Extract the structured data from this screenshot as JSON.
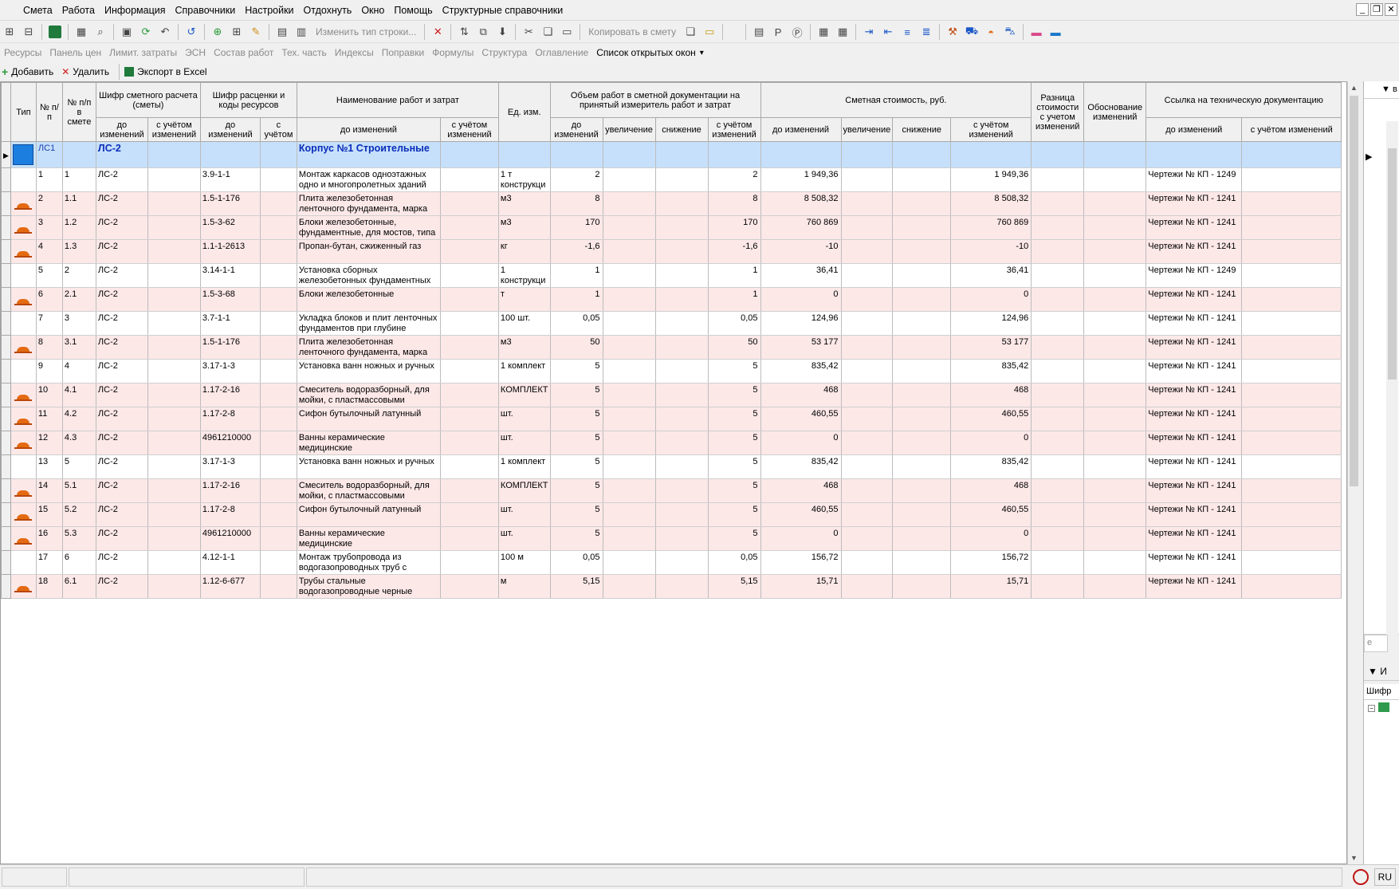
{
  "menu": [
    "Смета",
    "Работа",
    "Информация",
    "Справочники",
    "Настройки",
    "Отдохнуть",
    "Окно",
    "Помощь",
    "Структурные справочники"
  ],
  "toolbar": {
    "change_row_type": "Изменить тип строки...",
    "copy_to_estimate": "Копировать в смету"
  },
  "tabs": [
    "Ресурсы",
    "Панель цен",
    "Лимит. затраты",
    "ЭСН",
    "Состав работ",
    "Тех. часть",
    "Индексы",
    "Поправки",
    "Формулы",
    "Структура",
    "Оглавление",
    "Список открытых окон"
  ],
  "tabs_dropdown_icon": "chevron-down-icon",
  "actions": {
    "add": "Добавить",
    "delete": "Удалить",
    "export": "Экспорт в Excel"
  },
  "headers": {
    "type": "Тип",
    "num": "№ п/п",
    "num_in_estimate": "№ п/п в смете",
    "estimate_code": "Шифр сметного расчета (сметы)",
    "rate_code": "Шифр расценки и коды ресурсов",
    "name": "Наименование работ и затрат",
    "unit": "Ед. изм.",
    "volume": "Объем работ в сметной документации на принятый измеритель работ и затрат",
    "cost": "Сметная стоимость, руб.",
    "diff": "Разница стоимости с учетом изменений",
    "basis": "Обоснование изменений",
    "link": "Ссылка на техническую документацию",
    "before": "до изменений",
    "with_changes": "с учётом изменений",
    "with_short": "с учётом",
    "increase": "увеличение",
    "decrease": "снижение"
  },
  "ls_row": {
    "num": "ЛС1",
    "code": "ЛС-2",
    "name": "Корпус №1 Строительные"
  },
  "rows": [
    {
      "num": "1",
      "num2": "1",
      "code": "ЛС-2",
      "rate": "3.9-1-1",
      "name": "Монтаж каркасов одноэтажных одно и многопролетных зданий",
      "unit": "1 т конструкци",
      "vol": "2",
      "vol_after": "2",
      "cost": "1 949,36",
      "cost_after": "1 949,36",
      "link": "Чертежи № КП - 1249",
      "res": false
    },
    {
      "num": "2",
      "num2": "1.1",
      "code": "ЛС-2",
      "rate": "1.5-1-176",
      "name": "Плита железобетонная ленточного фундамента, марка",
      "unit": "м3",
      "vol": "8",
      "vol_after": "8",
      "cost": "8 508,32",
      "cost_after": "8 508,32",
      "link": "Чертежи № КП - 1241",
      "res": true
    },
    {
      "num": "3",
      "num2": "1.2",
      "code": "ЛС-2",
      "rate": "1.5-3-62",
      "name": "Блоки железобетонные, фундаментные, для мостов, типа",
      "unit": "м3",
      "vol": "170",
      "vol_after": "170",
      "cost": "760 869",
      "cost_after": "760 869",
      "link": "Чертежи № КП - 1241",
      "res": true
    },
    {
      "num": "4",
      "num2": "1.3",
      "code": "ЛС-2",
      "rate": "1.1-1-2613",
      "name": "Пропан-бутан, сжиженный газ",
      "unit": "кг",
      "vol": "-1,6",
      "vol_after": "-1,6",
      "cost": "-10",
      "cost_after": "-10",
      "link": "Чертежи № КП - 1241",
      "res": true
    },
    {
      "num": "5",
      "num2": "2",
      "code": "ЛС-2",
      "rate": "3.14-1-1",
      "name": "Установка сборных железобетонных фундаментных",
      "unit": "1 конструкци",
      "vol": "1",
      "vol_after": "1",
      "cost": "36,41",
      "cost_after": "36,41",
      "link": "Чертежи № КП - 1249",
      "res": false
    },
    {
      "num": "6",
      "num2": "2.1",
      "code": "ЛС-2",
      "rate": "1.5-3-68",
      "name": "Блоки железобетонные",
      "unit": "т",
      "vol": "1",
      "vol_after": "1",
      "cost": "0",
      "cost_after": "0",
      "link": "Чертежи № КП - 1241",
      "res": true
    },
    {
      "num": "7",
      "num2": "3",
      "code": "ЛС-2",
      "rate": "3.7-1-1",
      "name": "Укладка блоков и плит ленточных фундаментов при глубине",
      "unit": "100 шт.",
      "vol": "0,05",
      "vol_after": "0,05",
      "cost": "124,96",
      "cost_after": "124,96",
      "link": "Чертежи № КП - 1241",
      "res": false
    },
    {
      "num": "8",
      "num2": "3.1",
      "code": "ЛС-2",
      "rate": "1.5-1-176",
      "name": "Плита железобетонная ленточного фундамента, марка",
      "unit": "м3",
      "vol": "50",
      "vol_after": "50",
      "cost": "53 177",
      "cost_after": "53 177",
      "link": "Чертежи № КП - 1241",
      "res": true
    },
    {
      "num": "9",
      "num2": "4",
      "code": "ЛС-2",
      "rate": "3.17-1-3",
      "name": "Установка ванн ножных и ручных",
      "unit": "1 комплект",
      "vol": "5",
      "vol_after": "5",
      "cost": "835,42",
      "cost_after": "835,42",
      "link": "Чертежи № КП - 1241",
      "res": false
    },
    {
      "num": "10",
      "num2": "4.1",
      "code": "ЛС-2",
      "rate": "1.17-2-16",
      "name": "Смеситель водоразборный, для мойки, с пластмассовыми",
      "unit": "КОМПЛЕКТ",
      "vol": "5",
      "vol_after": "5",
      "cost": "468",
      "cost_after": "468",
      "link": "Чертежи № КП - 1241",
      "res": true
    },
    {
      "num": "11",
      "num2": "4.2",
      "code": "ЛС-2",
      "rate": "1.17-2-8",
      "name": "Сифон бутылочный латунный",
      "unit": "шт.",
      "vol": "5",
      "vol_after": "5",
      "cost": "460,55",
      "cost_after": "460,55",
      "link": "Чертежи № КП - 1241",
      "res": true
    },
    {
      "num": "12",
      "num2": "4.3",
      "code": "ЛС-2",
      "rate": "4961210000",
      "name": "Ванны керамические медицинские",
      "unit": "шт.",
      "vol": "5",
      "vol_after": "5",
      "cost": "0",
      "cost_after": "0",
      "link": "Чертежи № КП - 1241",
      "res": true
    },
    {
      "num": "13",
      "num2": "5",
      "code": "ЛС-2",
      "rate": "3.17-1-3",
      "name": "Установка ванн ножных и ручных",
      "unit": "1 комплект",
      "vol": "5",
      "vol_after": "5",
      "cost": "835,42",
      "cost_after": "835,42",
      "link": "Чертежи № КП - 1241",
      "res": false
    },
    {
      "num": "14",
      "num2": "5.1",
      "code": "ЛС-2",
      "rate": "1.17-2-16",
      "name": "Смеситель водоразборный, для мойки, с пластмассовыми",
      "unit": "КОМПЛЕКТ",
      "vol": "5",
      "vol_after": "5",
      "cost": "468",
      "cost_after": "468",
      "link": "Чертежи № КП - 1241",
      "res": true
    },
    {
      "num": "15",
      "num2": "5.2",
      "code": "ЛС-2",
      "rate": "1.17-2-8",
      "name": "Сифон бутылочный латунный",
      "unit": "шт.",
      "vol": "5",
      "vol_after": "5",
      "cost": "460,55",
      "cost_after": "460,55",
      "link": "Чертежи № КП - 1241",
      "res": true
    },
    {
      "num": "16",
      "num2": "5.3",
      "code": "ЛС-2",
      "rate": "4961210000",
      "name": "Ванны керамические медицинские",
      "unit": "шт.",
      "vol": "5",
      "vol_after": "5",
      "cost": "0",
      "cost_after": "0",
      "link": "Чертежи № КП - 1241",
      "res": true
    },
    {
      "num": "17",
      "num2": "6",
      "code": "ЛС-2",
      "rate": "4.12-1-1",
      "name": "Монтаж трубопровода из водогазопроводных труб с",
      "unit": "100 м",
      "vol": "0,05",
      "vol_after": "0,05",
      "cost": "156,72",
      "cost_after": "156,72",
      "link": "Чертежи № КП - 1241",
      "res": false
    },
    {
      "num": "18",
      "num2": "6.1",
      "code": "ЛС-2",
      "rate": "1.12-6-677",
      "name": "Трубы стальные водогазопроводные черные",
      "unit": "м",
      "vol": "5,15",
      "vol_after": "5,15",
      "cost": "15,71",
      "cost_after": "15,71",
      "link": "Чертежи № КП - 1241",
      "res": true
    }
  ],
  "side": {
    "header": "в",
    "section": "И",
    "col": "Шифр",
    "input": "е"
  },
  "status": {
    "lang": "RU"
  }
}
